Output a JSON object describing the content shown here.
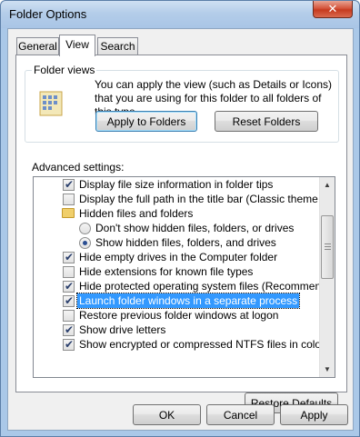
{
  "window": {
    "title": "Folder Options",
    "close_symbol": "✕"
  },
  "tabs": [
    {
      "label": "General"
    },
    {
      "label": "View"
    },
    {
      "label": "Search"
    }
  ],
  "folder_views": {
    "group_label": "Folder views",
    "description": "You can apply the view (such as Details or Icons) that you are using for this folder to all folders of this type.",
    "apply_label": "Apply to Folders",
    "reset_label": "Reset Folders"
  },
  "advanced": {
    "label": "Advanced settings:",
    "items": [
      {
        "kind": "checkbox",
        "checked": true,
        "label": "Display file size information in folder tips"
      },
      {
        "kind": "checkbox",
        "checked": false,
        "label": "Display the full path in the title bar (Classic theme only)"
      },
      {
        "kind": "folder",
        "label": "Hidden files and folders"
      },
      {
        "kind": "radio",
        "checked": false,
        "label": "Don't show hidden files, folders, or drives"
      },
      {
        "kind": "radio",
        "checked": true,
        "label": "Show hidden files, folders, and drives"
      },
      {
        "kind": "checkbox",
        "checked": true,
        "label": "Hide empty drives in the Computer folder"
      },
      {
        "kind": "checkbox",
        "checked": false,
        "label": "Hide extensions for known file types"
      },
      {
        "kind": "checkbox",
        "checked": true,
        "label": "Hide protected operating system files (Recommended)"
      },
      {
        "kind": "checkbox",
        "checked": true,
        "label": "Launch folder windows in a separate process"
      },
      {
        "kind": "checkbox",
        "checked": false,
        "label": "Restore previous folder windows at logon"
      },
      {
        "kind": "checkbox",
        "checked": true,
        "label": "Show drive letters"
      },
      {
        "kind": "checkbox",
        "checked": true,
        "label": "Show encrypted or compressed NTFS files in color"
      }
    ],
    "restore_label": "Restore Defaults"
  },
  "footer": {
    "ok_label": "OK",
    "cancel_label": "Cancel",
    "apply_label": "Apply"
  }
}
